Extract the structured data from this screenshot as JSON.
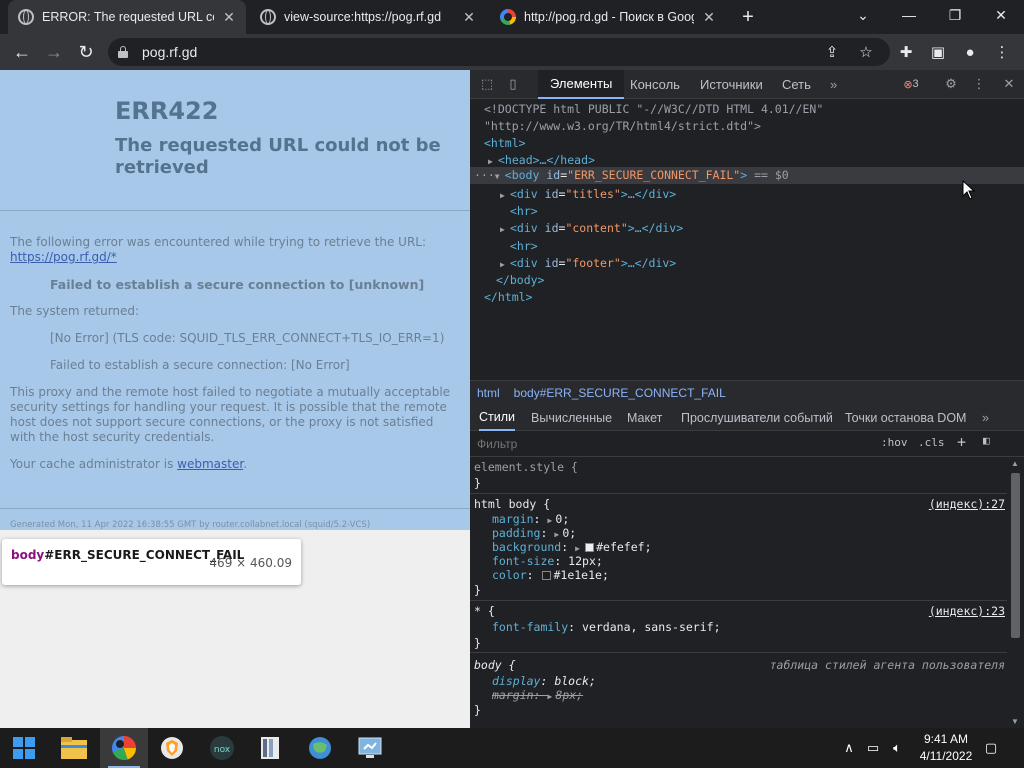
{
  "tabs": [
    {
      "title": "ERROR: The requested URL could",
      "icon": "globe-icon",
      "close": "✕",
      "active": true
    },
    {
      "title": "view-source:https://pog.rf.gd",
      "icon": "globe-icon",
      "close": "✕",
      "active": false
    },
    {
      "title": "http://pog.rd.gd - Поиск в Google",
      "icon": "google-icon",
      "close": "✕",
      "active": false
    }
  ],
  "new_tab": "+",
  "window_controls": {
    "minimize": "—",
    "restore": "❐",
    "close": "✕",
    "dropdown": "⌄"
  },
  "toolbar": {
    "url": "pog.rf.gd"
  },
  "page": {
    "title": "ERR422",
    "subtitle": "The requested URL could not be retrieved",
    "intro": "The following error was encountered while trying to retrieve the URL:",
    "url_link": "https://pog.rf.gd/*",
    "fail_msg": "Failed to establish a secure connection to [unknown]",
    "system_returned": "The system returned:",
    "err_detail": "[No Error] (TLS code: SQUID_TLS_ERR_CONNECT+TLS_IO_ERR=1)",
    "err_detail2": "Failed to establish a secure connection: [No Error]",
    "explanation": "This proxy and the remote host failed to negotiate a mutually acceptable security settings for handling your request. It is possible that the remote host does not support secure connections, or the proxy is not satisfied with the host security credentials.",
    "cache_prefix": "Your cache administrator is ",
    "cache_link": "webmaster",
    "cache_suffix": ".",
    "footer": "Generated Mon, 11 Apr 2022 16:38:55 GMT by router.collabnet.local (squid/5.2-VCS)"
  },
  "tooltip": {
    "tag": "body",
    "id": "#ERR_SECURE_CONNECT_FAIL",
    "dims": "469 × 460.09"
  },
  "devtools": {
    "tabs": [
      "Элементы",
      "Консоль",
      "Источники",
      "Сеть"
    ],
    "more": "»",
    "error_count": "3",
    "dom": {
      "doctype1": "<!DOCTYPE html PUBLIC \"-//W3C//DTD HTML 4.01//EN\"",
      "doctype2": "\"http://www.w3.org/TR/html4/strict.dtd\">",
      "html_open": "<html>",
      "head": "<head>…</head>",
      "body_tag": "<body",
      "body_attr_name": "id",
      "body_attr_value": "\"ERR_SECURE_CONNECT_FAIL\"",
      "body_close": ">",
      "selected_marker": "== $0",
      "dots": "···",
      "div_open": "<div",
      "id_attr": "id",
      "titles_val": "\"titles\"",
      "content_val": "\"content\"",
      "footer_val": "\"footer\"",
      "div_close": ">…</div>",
      "hr": "<hr>",
      "body_end": "</body>",
      "html_end": "</html>"
    },
    "breadcrumbs": [
      "html",
      "body#ERR_SECURE_CONNECT_FAIL"
    ],
    "style_tabs": [
      "Стили",
      "Вычисленные",
      "Макет",
      "Прослушиватели событий",
      "Точки останова DOM"
    ],
    "filter_placeholder": "Фильтр",
    "hov": ":hov",
    "cls": ".cls",
    "plus": "+",
    "rules": {
      "element_style": "element.style {",
      "close_brace": "}",
      "html_body_sel": "html body {",
      "html_body_src": "(индекс):27",
      "margin": "margin",
      "margin_val": "0;",
      "padding": "padding",
      "padding_val": "0;",
      "background": "background",
      "background_val": "#efefef;",
      "font_size": "font-size",
      "font_size_val": "12px;",
      "color": "color",
      "color_val": "#1e1e1e;",
      "star_sel": "* {",
      "star_src": "(индекс):23",
      "font_family": "font-family",
      "font_family_val": "verdana, sans-serif;",
      "body_sel": "body {",
      "body_src": "таблица стилей агента пользователя",
      "display": "display",
      "display_val": "block;",
      "ua_margin": "margin",
      "ua_margin_val": "8px;"
    }
  },
  "clock": {
    "time": "9:41 AM",
    "date": "4/11/2022"
  },
  "colors": {
    "page_bg": "#a8c8ea",
    "title": "#54738f",
    "accent": "#8ab4f8"
  }
}
